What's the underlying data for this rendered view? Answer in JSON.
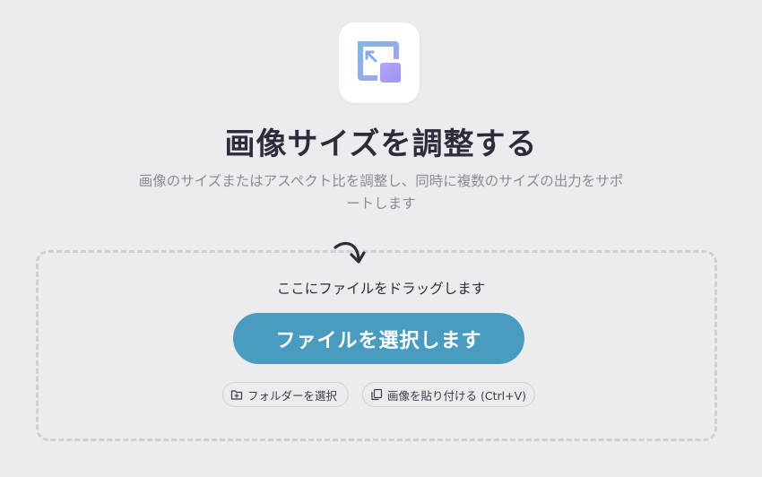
{
  "header": {
    "app_icon": "resize-image-icon",
    "title": "画像サイズを調整する",
    "subtitle": "画像のサイズまたはアスペクト比を調整し、同時に複数のサイズの出力をサポートします"
  },
  "dropzone": {
    "hint_icon": "curved-arrow-down-icon",
    "drag_text": "ここにファイルをドラッグします",
    "select_button_label": "ファイルを選択します",
    "folder_button": {
      "icon": "folder-plus-icon",
      "label": "フォルダーを選択"
    },
    "paste_button": {
      "icon": "copy-icon",
      "label": "画像を貼り付ける (Ctrl+V)"
    }
  },
  "colors": {
    "background": "#ececee",
    "accent": "#4a9bc0",
    "title": "#2b2d3a",
    "subtitle": "#8a8c96",
    "dashed_border": "#cfd0d5"
  }
}
